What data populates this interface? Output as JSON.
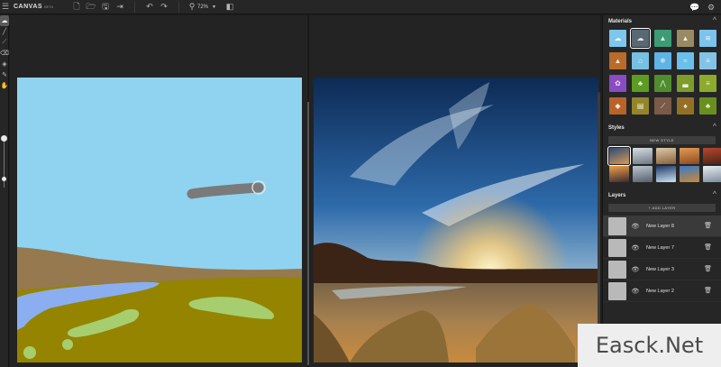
{
  "app": {
    "brand": "CANVAS",
    "brand_badge": "BETA"
  },
  "topbar": {
    "menu_icon": "hamburger-icon",
    "file_actions": [
      {
        "name": "new-file-button",
        "icon": "new-file-icon",
        "glyph": "🗋"
      },
      {
        "name": "open-file-button",
        "icon": "folder-open-icon",
        "glyph": "🗁"
      },
      {
        "name": "save-button",
        "icon": "save-icon",
        "glyph": "🖫"
      },
      {
        "name": "export-button",
        "icon": "export-icon",
        "glyph": "⇥"
      }
    ],
    "undo_icon": "undo-icon",
    "redo_icon": "redo-icon",
    "zoom_value": "72%",
    "right_actions": [
      {
        "name": "feedback-button",
        "icon": "chat-icon",
        "glyph": "💬"
      },
      {
        "name": "settings-button",
        "icon": "gear-icon",
        "glyph": "⚙"
      }
    ]
  },
  "toolbar": {
    "tools": [
      {
        "name": "material-brush-tool",
        "icon": "cloud-brush-icon",
        "glyph": "☁",
        "active": true
      },
      {
        "name": "brush-tool",
        "icon": "brush-icon",
        "glyph": "╱",
        "active": false
      },
      {
        "name": "line-tool",
        "icon": "line-icon",
        "glyph": "⟋",
        "active": false
      },
      {
        "name": "eraser-tool",
        "icon": "eraser-icon",
        "glyph": "⌫",
        "active": false
      },
      {
        "name": "fill-tool",
        "icon": "paint-bucket-icon",
        "glyph": "◈",
        "active": false
      },
      {
        "name": "eyedropper-tool",
        "icon": "eyedropper-icon",
        "glyph": "✎",
        "active": false
      },
      {
        "name": "pan-tool",
        "icon": "hand-icon",
        "glyph": "✋",
        "active": false
      }
    ],
    "brush_size": 0.82
  },
  "materials": {
    "title": "Materials",
    "items": [
      {
        "name": "cloud-icon",
        "color": "#7fc6ec",
        "glyph": "☁"
      },
      {
        "name": "cloud-selected-icon",
        "color": "#596872",
        "glyph": "☁",
        "selected": true
      },
      {
        "name": "mountain-icon",
        "color": "#3e9c74",
        "glyph": "▲"
      },
      {
        "name": "peak-icon",
        "color": "#9a8a64",
        "glyph": "▲"
      },
      {
        "name": "sky-icon",
        "color": "#7cc3ee",
        "glyph": "≋"
      },
      {
        "name": "dirt-icon",
        "color": "#b86b2a",
        "glyph": "▲"
      },
      {
        "name": "hut-icon",
        "color": "#76c0e2",
        "glyph": "⌂"
      },
      {
        "name": "snow-icon",
        "color": "#5fb4e6",
        "glyph": "❄"
      },
      {
        "name": "water-icon",
        "color": "#6ac0ea",
        "glyph": "≈"
      },
      {
        "name": "fog-icon",
        "color": "#83c3e6",
        "glyph": "≡"
      },
      {
        "name": "flower-icon",
        "color": "#8a4cc2",
        "glyph": "✿"
      },
      {
        "name": "bush-icon",
        "color": "#5d9c22",
        "glyph": "♣"
      },
      {
        "name": "grass-icon",
        "color": "#4f8d2e",
        "glyph": "⋀"
      },
      {
        "name": "field-icon",
        "color": "#7e9c2a",
        "glyph": "▃"
      },
      {
        "name": "meadow-icon",
        "color": "#8eaa2c",
        "glyph": "≡"
      },
      {
        "name": "rock-icon",
        "color": "#b8632a",
        "glyph": "◆"
      },
      {
        "name": "sand-icon",
        "color": "#93852a",
        "glyph": "▤"
      },
      {
        "name": "road-icon",
        "color": "#7a5a48",
        "glyph": "⟋"
      },
      {
        "name": "wood-icon",
        "color": "#947026",
        "glyph": "♠"
      },
      {
        "name": "tree-icon",
        "color": "#69901e",
        "glyph": "♣"
      }
    ]
  },
  "styles": {
    "title": "Styles",
    "new_style_label": "NEW STYLE",
    "items": [
      {
        "name": "style-sunset-sky",
        "gradient": "linear-gradient(160deg,#2a4a7a,#d89a52)",
        "selected": true
      },
      {
        "name": "style-cloudy-coast",
        "gradient": "linear-gradient(170deg,#d7dde4,#6e7784)"
      },
      {
        "name": "style-desert-rocks",
        "gradient": "linear-gradient(170deg,#e0c9a8,#86603e)"
      },
      {
        "name": "style-orange-canyon",
        "gradient": "linear-gradient(170deg,#e69a52,#8a4a22)"
      },
      {
        "name": "style-red-butte",
        "gradient": "linear-gradient(170deg,#b8472e,#4a2218)"
      },
      {
        "name": "style-dusk-sea",
        "gradient": "linear-gradient(170deg,#f0a048,#3a2a30)"
      },
      {
        "name": "style-misty-lake",
        "gradient": "linear-gradient(170deg,#bcc6cf,#56606c)"
      },
      {
        "name": "style-night-harbor",
        "gradient": "linear-gradient(170deg,#1c3a6a,#d0e2f2)"
      },
      {
        "name": "style-autumn-lake",
        "gradient": "linear-gradient(170deg,#3a78c4,#c88a3a)"
      },
      {
        "name": "style-snowy-peaks",
        "gradient": "linear-gradient(170deg,#e8edf2,#7c8c9a)"
      }
    ]
  },
  "layers": {
    "title": "Layers",
    "add_layer_label": "+ ADD LAYER",
    "items": [
      {
        "name": "New Layer 8",
        "active": true
      },
      {
        "name": "New Layer 7",
        "active": false
      },
      {
        "name": "New Layer 3",
        "active": false
      },
      {
        "name": "New Layer 2",
        "active": false
      }
    ]
  },
  "watermark": "Easck.Net"
}
